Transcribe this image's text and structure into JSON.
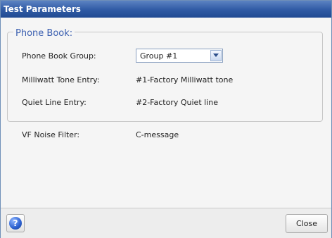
{
  "window": {
    "title": "Test Parameters"
  },
  "phone_book": {
    "legend": "Phone Book:",
    "group_label": "Phone Book Group:",
    "group_value": "Group #1",
    "milliwatt_label": "Milliwatt Tone Entry:",
    "milliwatt_value": "#1-Factory Milliwatt tone",
    "quiet_label": "Quiet Line Entry:",
    "quiet_value": "#2-Factory Quiet line"
  },
  "vf_noise_filter": {
    "label": "VF Noise Filter:",
    "value": "C-message"
  },
  "footer": {
    "help_icon": "help-icon",
    "help_glyph": "?",
    "close_label": "Close"
  },
  "colors": {
    "title_bar": "#2f5aa4",
    "legend_text": "#3b5fb0"
  }
}
